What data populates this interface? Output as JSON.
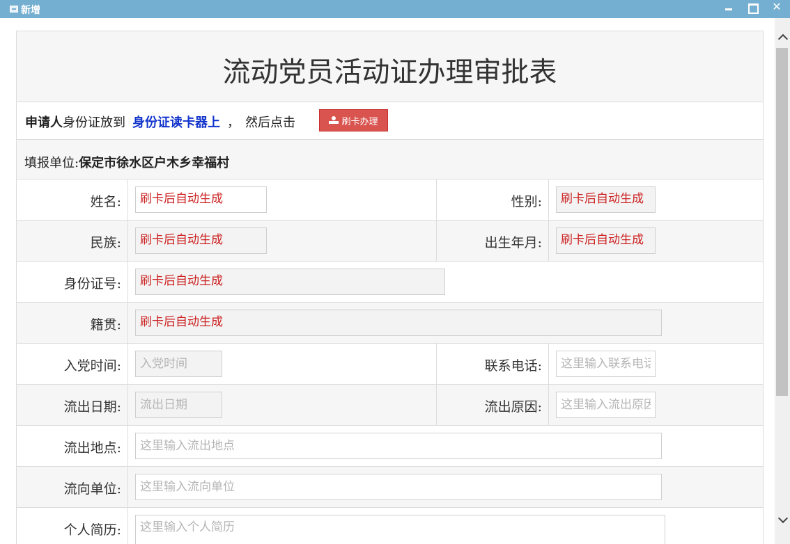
{
  "window": {
    "title": "新增",
    "icon": "form-window-icon",
    "controls": {
      "minimize": "minimize-icon",
      "maximize": "maximize-icon",
      "close": "✕"
    }
  },
  "form": {
    "title": "流动党员活动证办理审批表",
    "instruction": {
      "applicant": "申请人",
      "text1": "身份证放到",
      "reader": "身份证读卡器上",
      "comma": "，",
      "text2": "然后点击",
      "button_label": "刷卡办理",
      "button_icon": "id-card-icon"
    },
    "unit": {
      "label": "填报单位:",
      "value": "保定市徐水区户木乡幸福村"
    },
    "fields": {
      "name": {
        "label": "姓名:",
        "value": "刷卡后自动生成"
      },
      "gender": {
        "label": "性别:",
        "value": "刷卡后自动生成"
      },
      "ethnicity": {
        "label": "民族:",
        "value": "刷卡后自动生成"
      },
      "birth": {
        "label": "出生年月:",
        "value": "刷卡后自动生成"
      },
      "id_number": {
        "label": "身份证号:",
        "value": "刷卡后自动生成"
      },
      "native_place": {
        "label": "籍贯:",
        "value": "刷卡后自动生成"
      },
      "join_date": {
        "label": "入党时间:",
        "placeholder": "入党时间"
      },
      "phone": {
        "label": "联系电话:",
        "placeholder": "这里输入联系电话"
      },
      "outflow_date": {
        "label": "流出日期:",
        "placeholder": "流出日期"
      },
      "outflow_reason": {
        "label": "流出原因:",
        "placeholder": "这里输入流出原因"
      },
      "outflow_place": {
        "label": "流出地点:",
        "placeholder": "这里输入流出地点"
      },
      "destination_unit": {
        "label": "流向单位:",
        "placeholder": "这里输入流向单位"
      },
      "resume": {
        "label": "个人简历:",
        "placeholder": "这里输入个人简历"
      }
    }
  },
  "colors": {
    "titlebar": "#74aed0",
    "auto_text": "#cc1f1f",
    "emphasis_blue": "#1133cc",
    "button_red": "#d9534f"
  }
}
